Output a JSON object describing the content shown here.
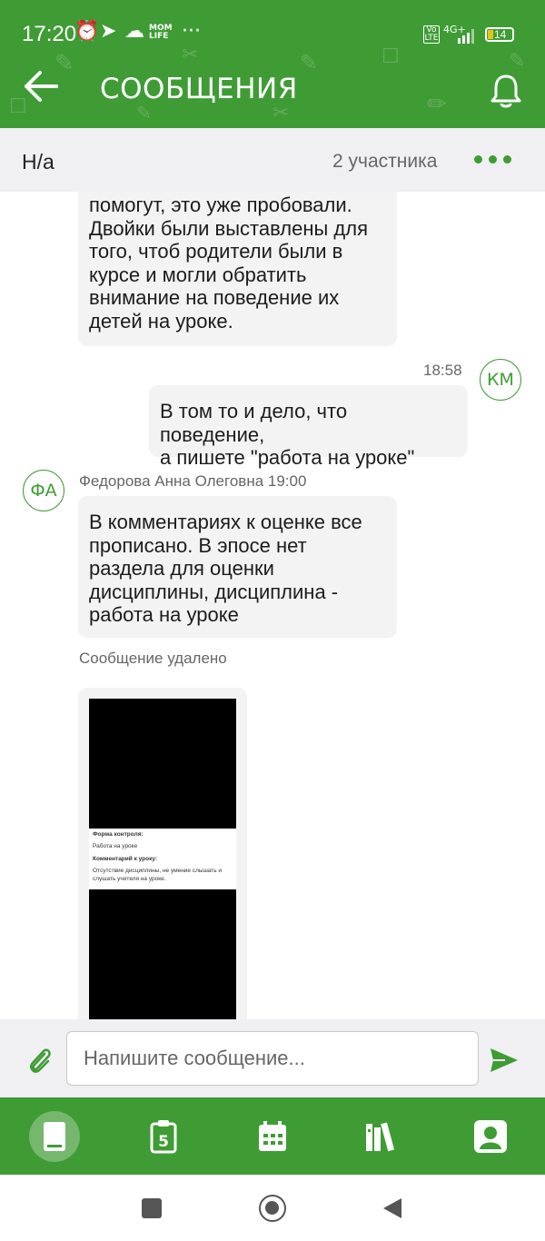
{
  "status_bar": {
    "time": "17:20",
    "icons": [
      "alarm-icon",
      "telegram-icon",
      "cloud-upload-icon",
      "mom-life-icon",
      "more-dots"
    ],
    "mom_life_label": "MOM LIFE",
    "network": "4G+",
    "volte": "Vo LTE",
    "battery": "14"
  },
  "header": {
    "title": "СООБЩЕНИЯ",
    "accent_color": "#3f9c35"
  },
  "chat": {
    "name": "Н/а",
    "participants": "2 участника"
  },
  "messages": [
    {
      "side": "left",
      "lines": [
        "помогут, это уже пробовали.",
        "Двойки были выставлены для",
        "того, чтоб родители были в",
        "курсе и могли обратить",
        "внимание на поведение их",
        "детей на уроке."
      ]
    },
    {
      "side": "right",
      "time": "18:58",
      "avatar": "КМ",
      "lines": [
        "В том то и дело, что поведение,",
        "а пишете \"работа на уроке\""
      ]
    },
    {
      "side": "left",
      "avatar": "ФА",
      "author_time": "Федорова Анна Олеговна 19:00",
      "lines": [
        "В комментариях к оценке все",
        "прописано. В эпосе нет",
        "раздела для оценки",
        "дисциплины, дисциплина -",
        "работа на уроке"
      ]
    }
  ],
  "deleted_notice": "Сообщение удалено",
  "attachment": {
    "form_label": "Форма контроля:",
    "form_value": "Работа на уроке",
    "comment_label": "Комментарий к уроку:",
    "comment_lines": [
      "Отсутствие дисциплины, не умение слышать и",
      "слушать учителя на уроке."
    ]
  },
  "composer": {
    "placeholder": "Напишите сообщение..."
  },
  "bottom_nav": [
    "diary-icon",
    "homework-icon",
    "calendar-icon",
    "library-icon",
    "profile-icon"
  ]
}
